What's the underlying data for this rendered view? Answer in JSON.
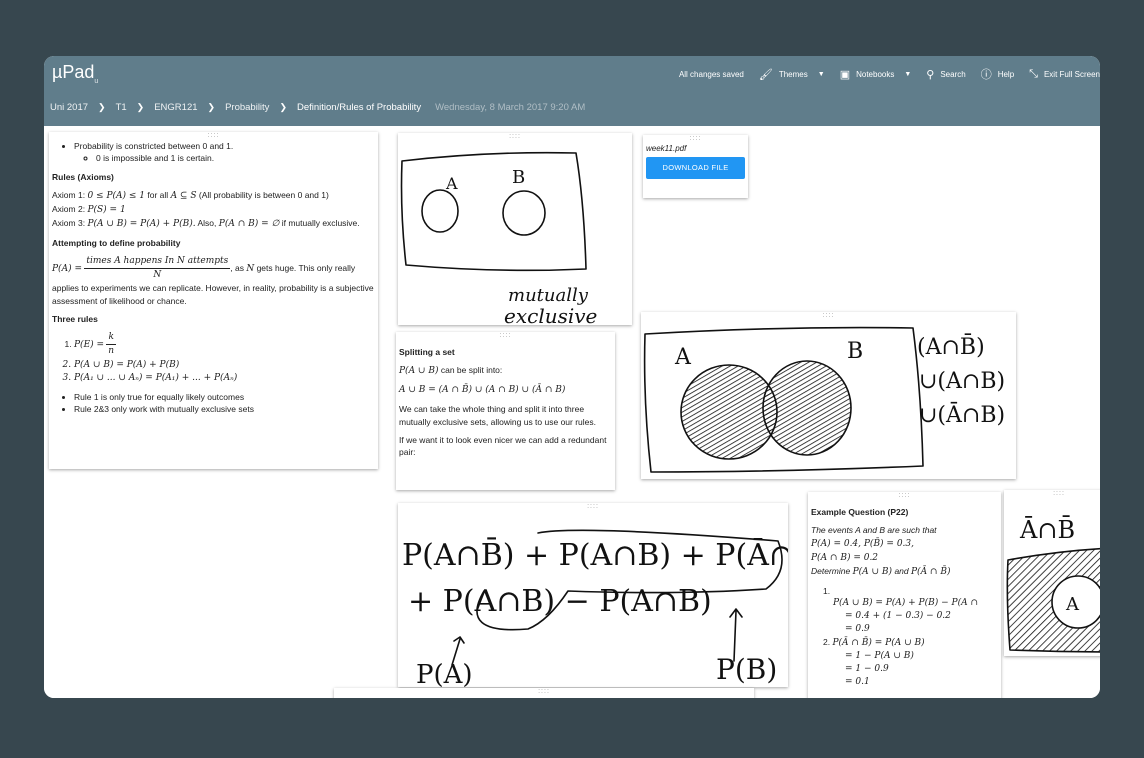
{
  "app": {
    "logo": "µPad",
    "logo_sub": "u"
  },
  "actions": {
    "status": "All changes saved",
    "themes": "Themes",
    "notebooks": "Notebooks",
    "search": "Search",
    "help": "Help",
    "exit_fullscreen": "Exit Full Screen"
  },
  "breadcrumbs": [
    "Uni 2017",
    "T1",
    "ENGR121",
    "Probability",
    "Definition/Rules of Probability"
  ],
  "date": "Wednesday, 8 March 2017 9:20 AM",
  "icons": [
    "paint-roller-icon",
    "book-icon",
    "search-icon",
    "help-icon",
    "fullscreen-exit-icon",
    "caret-down-icon",
    "chevron-right-icon"
  ],
  "note1": {
    "bullet1": "Probability is constricted between 0 and 1.",
    "bullet1a": "0 is impossible and 1 is certain.",
    "rules_heading": "Rules (Axioms)",
    "axiom1_prefix": "Axiom 1:",
    "axiom1_math": "0 ≤ P(A) ≤ 1",
    "axiom1_for": "for all",
    "axiom1_math2": "A ⊆ S",
    "axiom1_suffix": "(All probability is between 0 and 1)",
    "axiom2_prefix": "Axiom 2:",
    "axiom2_math": "P(S) = 1",
    "axiom3_prefix": "Axiom 3:",
    "axiom3_math": "P(A ∪ B) = P(A) + P(B).",
    "axiom3_also": "Also,",
    "axiom3_math2": "P(A ∩ B) = ∅",
    "axiom3_suffix": "if mutually exclusive.",
    "attempt_heading": "Attempting to define probability",
    "formula_lhs": "P(A) =",
    "formula_num": "times A happens In N attempts",
    "formula_den": "N",
    "attempt_text1": ", as",
    "attempt_N": "N",
    "attempt_text2": "gets huge. This only really applies to experiments we can replicate. However, in reality, probability is a subjective assessment of likelihood or chance.",
    "three_heading": "Three rules",
    "rule1_lhs": "P(E) =",
    "rule1_num": "k",
    "rule1_den": "n",
    "rule2": "P(A ∪ B) = P(A) + P(B)",
    "rule3": "P(A₁ ∪ ... ∪ Aₙ) = P(A₁) + ... + P(Aₙ)",
    "note_a": "Rule 1 is only true for equally likely outcomes",
    "note_b": "Rule 2&3 only work with mutually exclusive sets"
  },
  "drawing1": {
    "label_a": "A",
    "label_b": "B",
    "caption1": "mutually",
    "caption2": "exclusive"
  },
  "file": {
    "name": "week11.pdf",
    "button": "DOWNLOAD FILE"
  },
  "drawing2": {
    "label_a": "A",
    "label_b": "B",
    "eq1": "(A∩B̄)",
    "eq2": "∪(A∩B)",
    "eq3": "∪(Ā∩B)"
  },
  "note2": {
    "heading": "Splitting a set",
    "line1_math": "P(A ∪ B)",
    "line1_text": "can be split into:",
    "eq": "A ∪ B = (A ∩ B̄) ∪ (A ∩ B) ∪ (Ā ∩ B)",
    "para1": "We can take the whole thing and split it into three mutually exclusive sets, allowing us to use our rules.",
    "para2": "If we want it to look even nicer we can add a redundant pair:"
  },
  "drawing3": {
    "top": "P(A∩B̄) + P(A∩B) + P(Ā∩B)",
    "mid": "+ P(A∩B) − P(A∩B)",
    "pa": "P(A)",
    "pb": "P(B)"
  },
  "note3": {
    "heading": "Example Question (P22)",
    "given": "The events A and B are such that",
    "g1": "P(A) = 0.4, P(B̄) = 0.3,",
    "g2": "P(A ∩ B) = 0.2",
    "determine": "Determine",
    "d1": "P(A ∪ B)",
    "and": "and",
    "d2": "P(Ā ∩ B̄)",
    "s1_num": "1.",
    "s1a": "P(A ∪ B) = P(A) + P(B) − P(A ∩",
    "s1b": "= 0.4 + (1 − 0.3) − 0.2",
    "s1c": "= 0.9",
    "s2a": "P(Ā ∩ B̄) = P(A ∪ B)",
    "s2b": "= 1 − P(A ∪ B)",
    "s2c": "= 1 − 0.9",
    "s2d": "= 0.1"
  },
  "drawing4": {
    "label": "Ā∩B̄",
    "label_a": "A"
  }
}
